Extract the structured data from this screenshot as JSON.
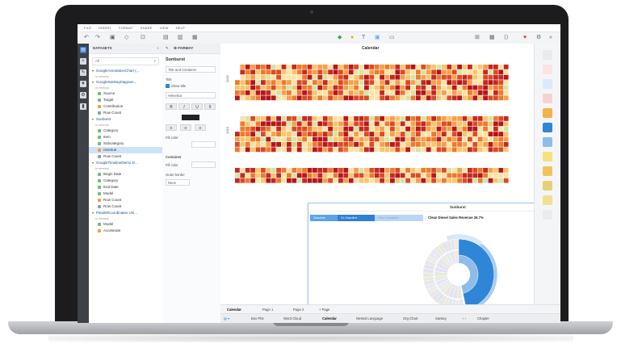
{
  "menu": [
    "FILE",
    "INSERT",
    "FORMAT",
    "SHARE",
    "VIEW",
    "HELP"
  ],
  "datasets_panel": {
    "header": "DATASETS",
    "search_value": "All",
    "tree": [
      {
        "kind": "group",
        "label": "GoogleAnnotationChart (...",
        "sub": "In memory"
      },
      {
        "kind": "group",
        "label": "GoogleSankeyDiagram...",
        "sub": "In memory"
      },
      {
        "kind": "field",
        "type": "dim",
        "label": "Source"
      },
      {
        "kind": "field",
        "type": "dim",
        "label": "Target"
      },
      {
        "kind": "field",
        "type": "mea",
        "label": "Contribution"
      },
      {
        "kind": "field",
        "type": "cnt",
        "label": "Row Count"
      },
      {
        "kind": "group",
        "label": "Sunburst",
        "sub": "In memory"
      },
      {
        "kind": "field",
        "type": "dim",
        "label": "Category"
      },
      {
        "kind": "field",
        "type": "dim",
        "label": "Item"
      },
      {
        "kind": "field",
        "type": "dim",
        "label": "Subcategory"
      },
      {
        "kind": "field",
        "type": "mea",
        "label": "revenue",
        "selected": true
      },
      {
        "kind": "field",
        "type": "cnt",
        "label": "Row Count"
      },
      {
        "kind": "group",
        "label": "GoogleTimelineDemo D...",
        "sub": "In memory"
      },
      {
        "kind": "field",
        "type": "dim",
        "label": "Begin Date"
      },
      {
        "kind": "field",
        "type": "dim",
        "label": "Category"
      },
      {
        "kind": "field",
        "type": "dim",
        "label": "End Date"
      },
      {
        "kind": "field",
        "type": "dim",
        "label": "Model"
      },
      {
        "kind": "field",
        "type": "mea",
        "label": "Row Count"
      },
      {
        "kind": "field",
        "type": "cnt",
        "label": "Row Count"
      },
      {
        "kind": "group",
        "label": "ParallelCoordinates Uni...",
        "sub": "In memory"
      },
      {
        "kind": "field",
        "type": "dim",
        "label": "Model"
      },
      {
        "kind": "field",
        "type": "mea",
        "label": "Accelerate"
      }
    ]
  },
  "format_panel": {
    "tab": "FORMAT",
    "title": "Sunburst",
    "section_select": "Title and Container",
    "title_label": "Title",
    "show_title": "Show title",
    "font": "Helvetica",
    "bold": "B",
    "italic": "I",
    "underline": "U",
    "font_size": "9",
    "fill_label": "Fill color",
    "container_label": "Container",
    "fill_label_2": "Fill color",
    "outer_border": "Outer border",
    "border_value": "None"
  },
  "canvas": {
    "calendar_title": "Calendar",
    "years": [
      "2015",
      "2016"
    ],
    "sunburst_panel": {
      "title": "Sunburst",
      "crumbs": [
        "Gasoline",
        "01-Gasoline",
        "SKU-Unleaded"
      ],
      "breadcrumb_text": "Clean Diesel Sales Revenue 26.7%"
    }
  },
  "page_tabs": [
    "Calendar",
    "Page 1",
    "Page 2",
    "+ Page"
  ],
  "sheet_tabs": [
    "Box Plot",
    "Word Cloud",
    "Calendar",
    "Nested Language",
    "Org Chart",
    "Sankey",
    "Chapter"
  ],
  "colors": {
    "heat_low": "#fbe3a5",
    "heat_mid": "#ef7a2b",
    "heat_high": "#b8151b",
    "accent": "#2f7fd4",
    "sunburst_main": "#2f86d6"
  }
}
